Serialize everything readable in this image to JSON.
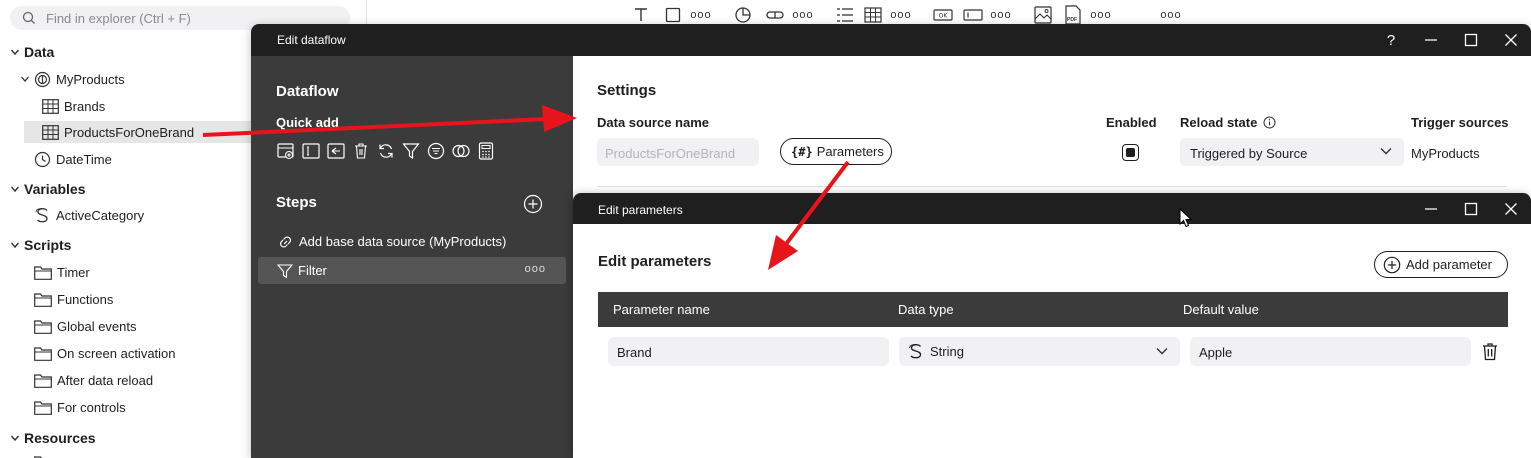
{
  "explorer": {
    "search_placeholder": "Find in explorer (Ctrl + F)",
    "tree": {
      "data": "Data",
      "myproducts": "MyProducts",
      "brands": "Brands",
      "productsforonebrand": "ProductsForOneBrand",
      "datetime": "DateTime",
      "variables": "Variables",
      "activecategory": "ActiveCategory",
      "scripts": "Scripts",
      "timer": "Timer",
      "functions": "Functions",
      "global_events": "Global events",
      "on_screen_activation": "On screen activation",
      "after_data_reload": "After data reload",
      "for_controls": "For controls",
      "resources": "Resources"
    }
  },
  "toolbar": {
    "more": "ooo",
    "pdf_badge": "PDF"
  },
  "dataflow_window": {
    "title": "Edit dataflow",
    "help": "?",
    "panel_title": "Dataflow",
    "quick_add": "Quick add",
    "steps_title": "Steps",
    "steps": {
      "base": "Add base data source (MyProducts)",
      "filter": "Filter",
      "more": "ooo"
    },
    "settings": {
      "title": "Settings",
      "data_source_name_label": "Data source name",
      "data_source_name_value": "ProductsForOneBrand",
      "parameters_button": "Parameters",
      "parameters_icon": "{#}",
      "enabled_label": "Enabled",
      "enabled": true,
      "reload_state_label": "Reload state",
      "reload_state_value": "Triggered by Source",
      "trigger_sources_label": "Trigger sources",
      "trigger_sources_value": "MyProducts"
    }
  },
  "parameters_window": {
    "title": "Edit parameters",
    "heading": "Edit parameters",
    "add_button": "Add parameter",
    "columns": {
      "name": "Parameter name",
      "type": "Data type",
      "default": "Default value"
    },
    "row": {
      "name": "Brand",
      "type": "String",
      "default": "Apple"
    }
  },
  "colors": {
    "titlebar": "#1f1f1f",
    "panel_dark": "#3b3b3b",
    "field_bg": "#f1f1f4",
    "annotation_arrow": "#e8141c"
  }
}
